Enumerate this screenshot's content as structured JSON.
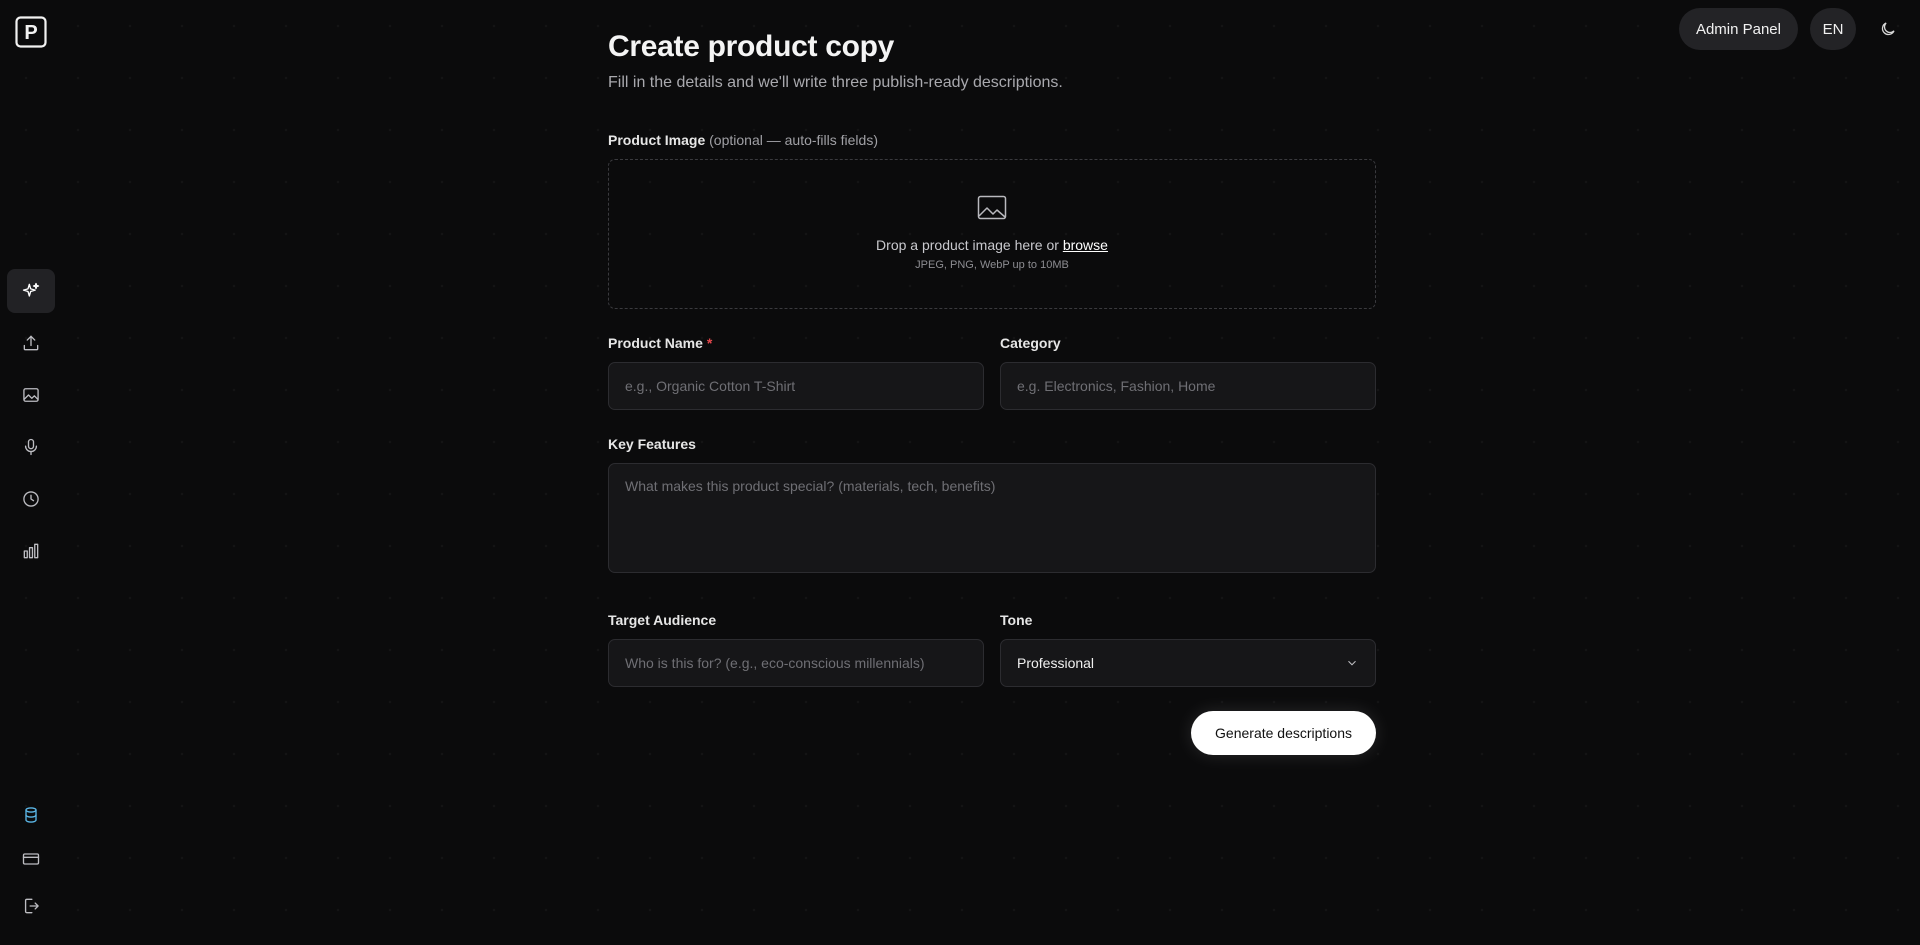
{
  "topbar": {
    "admin_label": "Admin Panel",
    "lang_label": "EN",
    "theme_icon": "moon-icon"
  },
  "sidebar": {
    "logo_letter": "P",
    "items": [
      {
        "name": "create",
        "icon": "sparkles-icon",
        "active": true
      },
      {
        "name": "upload",
        "icon": "upload-icon"
      },
      {
        "name": "images",
        "icon": "image-icon"
      },
      {
        "name": "voice",
        "icon": "microphone-icon"
      },
      {
        "name": "history",
        "icon": "clock-icon"
      },
      {
        "name": "analytics",
        "icon": "bar-chart-icon"
      }
    ],
    "bottom_items": [
      {
        "name": "database",
        "icon": "database-icon",
        "color": "#5bb6e6"
      },
      {
        "name": "billing",
        "icon": "credit-card-icon"
      },
      {
        "name": "logout",
        "icon": "logout-icon"
      }
    ]
  },
  "main": {
    "title": "Create product copy",
    "subtitle": "Fill in the details and we'll write three publish-ready descriptions.",
    "image_field": {
      "label": "Product Image",
      "optional_note": "(optional — auto-fills fields)",
      "drop_text": "Drop a product image here or ",
      "browse_label": "browse",
      "hint": "JPEG, PNG, WebP up to 10MB"
    },
    "product_name": {
      "label": "Product Name",
      "required_mark": "*",
      "placeholder": "e.g., Organic Cotton T-Shirt"
    },
    "category": {
      "label": "Category",
      "placeholder": "e.g. Electronics, Fashion, Home"
    },
    "key_features": {
      "label": "Key Features",
      "placeholder": "What makes this product special? (materials, tech, benefits)"
    },
    "target_audience": {
      "label": "Target Audience",
      "placeholder": "Who is this for? (e.g., eco-conscious millennials)"
    },
    "tone": {
      "label": "Tone",
      "value": "Professional"
    },
    "generate_label": "Generate descriptions"
  }
}
